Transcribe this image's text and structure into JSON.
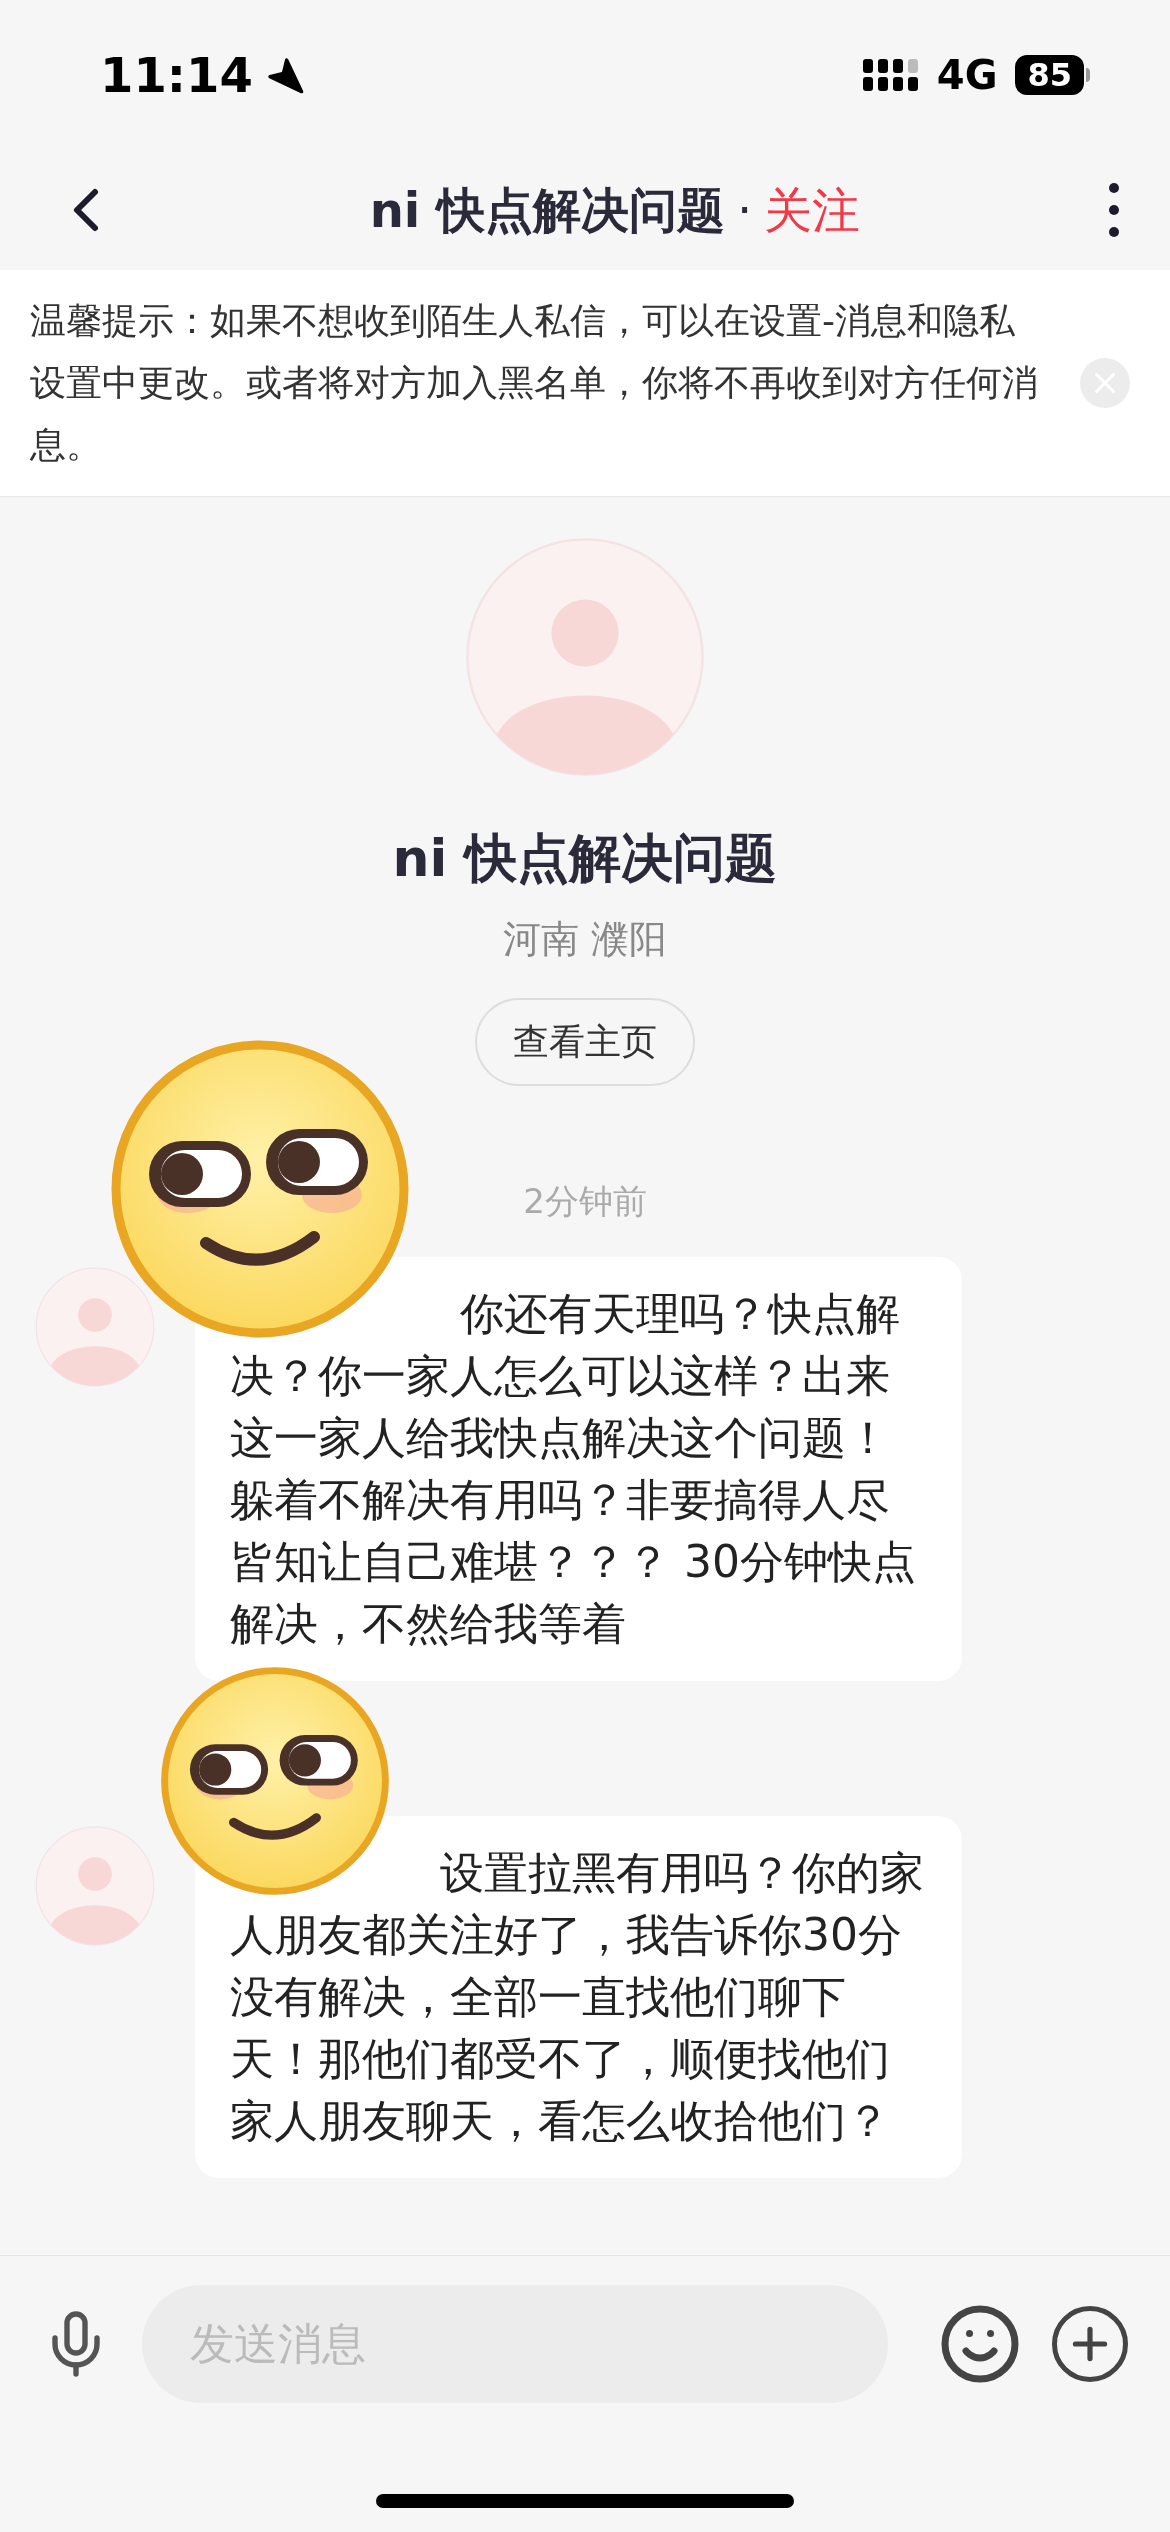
{
  "status_bar": {
    "time": "11:14",
    "network": "4G",
    "battery": "85"
  },
  "header": {
    "title": "ni 快点解决问题",
    "separator": "·",
    "follow": "关注"
  },
  "notice": {
    "text": "温馨提示：如果不想收到陌生人私信，可以在设置-消息和隐私设置中更改。或者将对方加入黑名单，你将不再收到对方任何消息。"
  },
  "profile": {
    "name": "ni 快点解决问题",
    "location": "河南 濮阳",
    "button": "查看主页"
  },
  "timestamp": "2分钟前",
  "messages": [
    {
      "text": "你还有天理吗？快点解决？你一家人怎么可以这样？出来这一家人给我快点解决这个问题！躲着不解决有用吗？非要搞得人尽皆知让自己难堪？？？ 30分钟快点解决，不然给我等着"
    },
    {
      "text": "设置拉黑有用吗？你的家人朋友都关注好了，我告诉你30分没有解决，全部一直找他们聊下天！那他们都受不了，顺便找他们家人朋友聊天，看怎么收拾他们？"
    }
  ],
  "composer": {
    "placeholder": "发送消息"
  }
}
